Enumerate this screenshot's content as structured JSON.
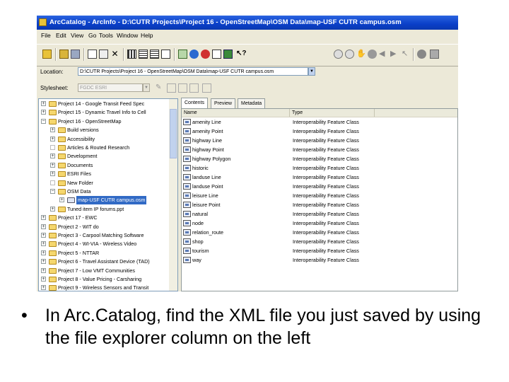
{
  "window": {
    "title": "ArcCatalog - ArcInfo - D:\\CUTR Projects\\Project 16 - OpenStreetMap\\OSM Data\\map-USF CUTR campus.osm"
  },
  "menu": [
    "File",
    "Edit",
    "View",
    "Go",
    "Tools",
    "Window",
    "Help"
  ],
  "location": {
    "label": "Location:",
    "value": "D:\\CUTR Projects\\Project 16 - OpenStreetMap\\OSM Data\\map-USF CUTR campus.osm"
  },
  "stylesheet": {
    "label": "Stylesheet:",
    "value": "FGDC ESRI"
  },
  "tree": [
    {
      "label": "Project 14 - Google Transit Feed Spec",
      "level": 0,
      "expander": "+"
    },
    {
      "label": "Project 15 - Dynamic Travel Info to Cell",
      "level": 0,
      "expander": "+"
    },
    {
      "label": "Project 16 - OpenStreetMap",
      "level": 0,
      "expander": "-"
    },
    {
      "label": "Build versions",
      "level": 1,
      "expander": "+"
    },
    {
      "label": "Accessibility",
      "level": 1,
      "expander": "+"
    },
    {
      "label": "Articles & Routed Research",
      "level": 1,
      "expander": ""
    },
    {
      "label": "Development",
      "level": 1,
      "expander": "+"
    },
    {
      "label": "Documents",
      "level": 1,
      "expander": "+"
    },
    {
      "label": "ESRI Files",
      "level": 1,
      "expander": "+"
    },
    {
      "label": "New Folder",
      "level": 1,
      "expander": ""
    },
    {
      "label": "OSM Data",
      "level": 1,
      "expander": "-"
    },
    {
      "label": "map-USF CUTR campus.osm",
      "level": 2,
      "expander": "+",
      "selected": true
    },
    {
      "label": "Tuned item IP forums.ppt",
      "level": 1,
      "expander": "+"
    },
    {
      "label": "Project 17 - EWC",
      "level": 0,
      "expander": "+"
    },
    {
      "label": "Project 2 - WIT do",
      "level": 0,
      "expander": "+"
    },
    {
      "label": "Project 3 - Carpool Matching Software",
      "level": 0,
      "expander": "+"
    },
    {
      "label": "Project 4 - WI-VIA - Wireless Video",
      "level": 0,
      "expander": "+"
    },
    {
      "label": "Project 5 - NTTAR",
      "level": 0,
      "expander": "+"
    },
    {
      "label": "Project 6 - Travel Assistant Device (TAD)",
      "level": 0,
      "expander": "+"
    },
    {
      "label": "Project 7 - Low VMT Communities",
      "level": 0,
      "expander": "+"
    },
    {
      "label": "Project 8 - Value Pricing - Carsharing",
      "level": 0,
      "expander": "+"
    },
    {
      "label": "Project 9 - Wireless Sensors and Transit",
      "level": 0,
      "expander": "+"
    }
  ],
  "tabs": [
    "Contents",
    "Preview",
    "Metadata"
  ],
  "columns": [
    "Name",
    "Type"
  ],
  "rows": [
    {
      "name": "amenity Line",
      "type": "Interoperability Feature Class"
    },
    {
      "name": "amenity Point",
      "type": "Interoperability Feature Class"
    },
    {
      "name": "highway Line",
      "type": "Interoperability Feature Class"
    },
    {
      "name": "highway Point",
      "type": "Interoperability Feature Class"
    },
    {
      "name": "highway Polygon",
      "type": "Interoperability Feature Class"
    },
    {
      "name": "historic",
      "type": "Interoperability Feature Class"
    },
    {
      "name": "landuse Line",
      "type": "Interoperability Feature Class"
    },
    {
      "name": "landuse Point",
      "type": "Interoperability Feature Class"
    },
    {
      "name": "leisure Line",
      "type": "Interoperability Feature Class"
    },
    {
      "name": "leisure Point",
      "type": "Interoperability Feature Class"
    },
    {
      "name": "natural",
      "type": "Interoperability Feature Class"
    },
    {
      "name": "node",
      "type": "Interoperability Feature Class"
    },
    {
      "name": "relation_route",
      "type": "Interoperability Feature Class"
    },
    {
      "name": "shop",
      "type": "Interoperability Feature Class"
    },
    {
      "name": "tourism",
      "type": "Interoperability Feature Class"
    },
    {
      "name": "way",
      "type": "Interoperability Feature Class"
    }
  ],
  "caption": {
    "bullet": "•",
    "text": "In Arc.Catalog, find the XML file you just saved by using the file explorer column on the left"
  }
}
